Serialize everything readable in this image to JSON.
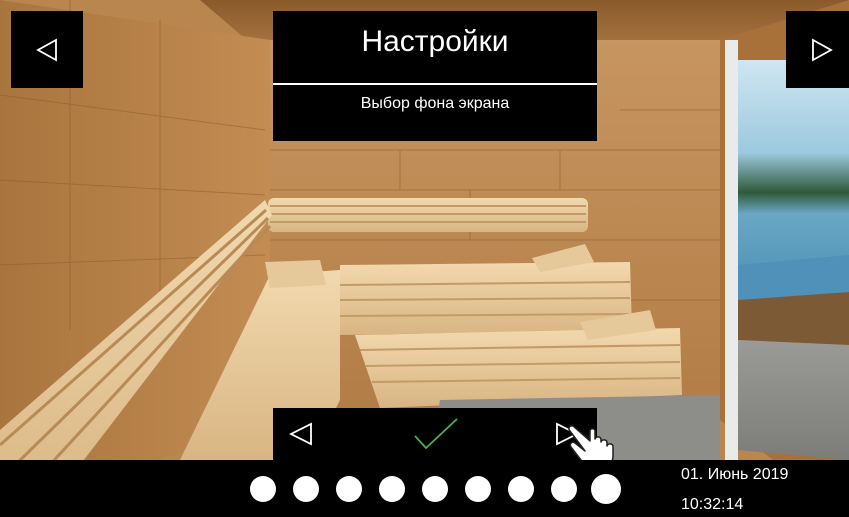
{
  "header": {
    "title": "Настройки",
    "subtitle": "Выбор фона экрана"
  },
  "nav": {
    "prev_icon": "triangle-left-icon",
    "next_icon": "triangle-right-icon"
  },
  "selector": {
    "prev_icon": "triangle-left-icon",
    "confirm_icon": "checkmark-icon",
    "next_icon": "triangle-right-icon",
    "pointer_icon": "hand-pointer-icon",
    "confirm_color": "#4caf50",
    "dots_total": 9,
    "selected_index": 9
  },
  "status": {
    "date": "01. Июнь 2019",
    "time": "10:32:14"
  },
  "colors": {
    "bars": "#000000",
    "text": "#ffffff"
  }
}
